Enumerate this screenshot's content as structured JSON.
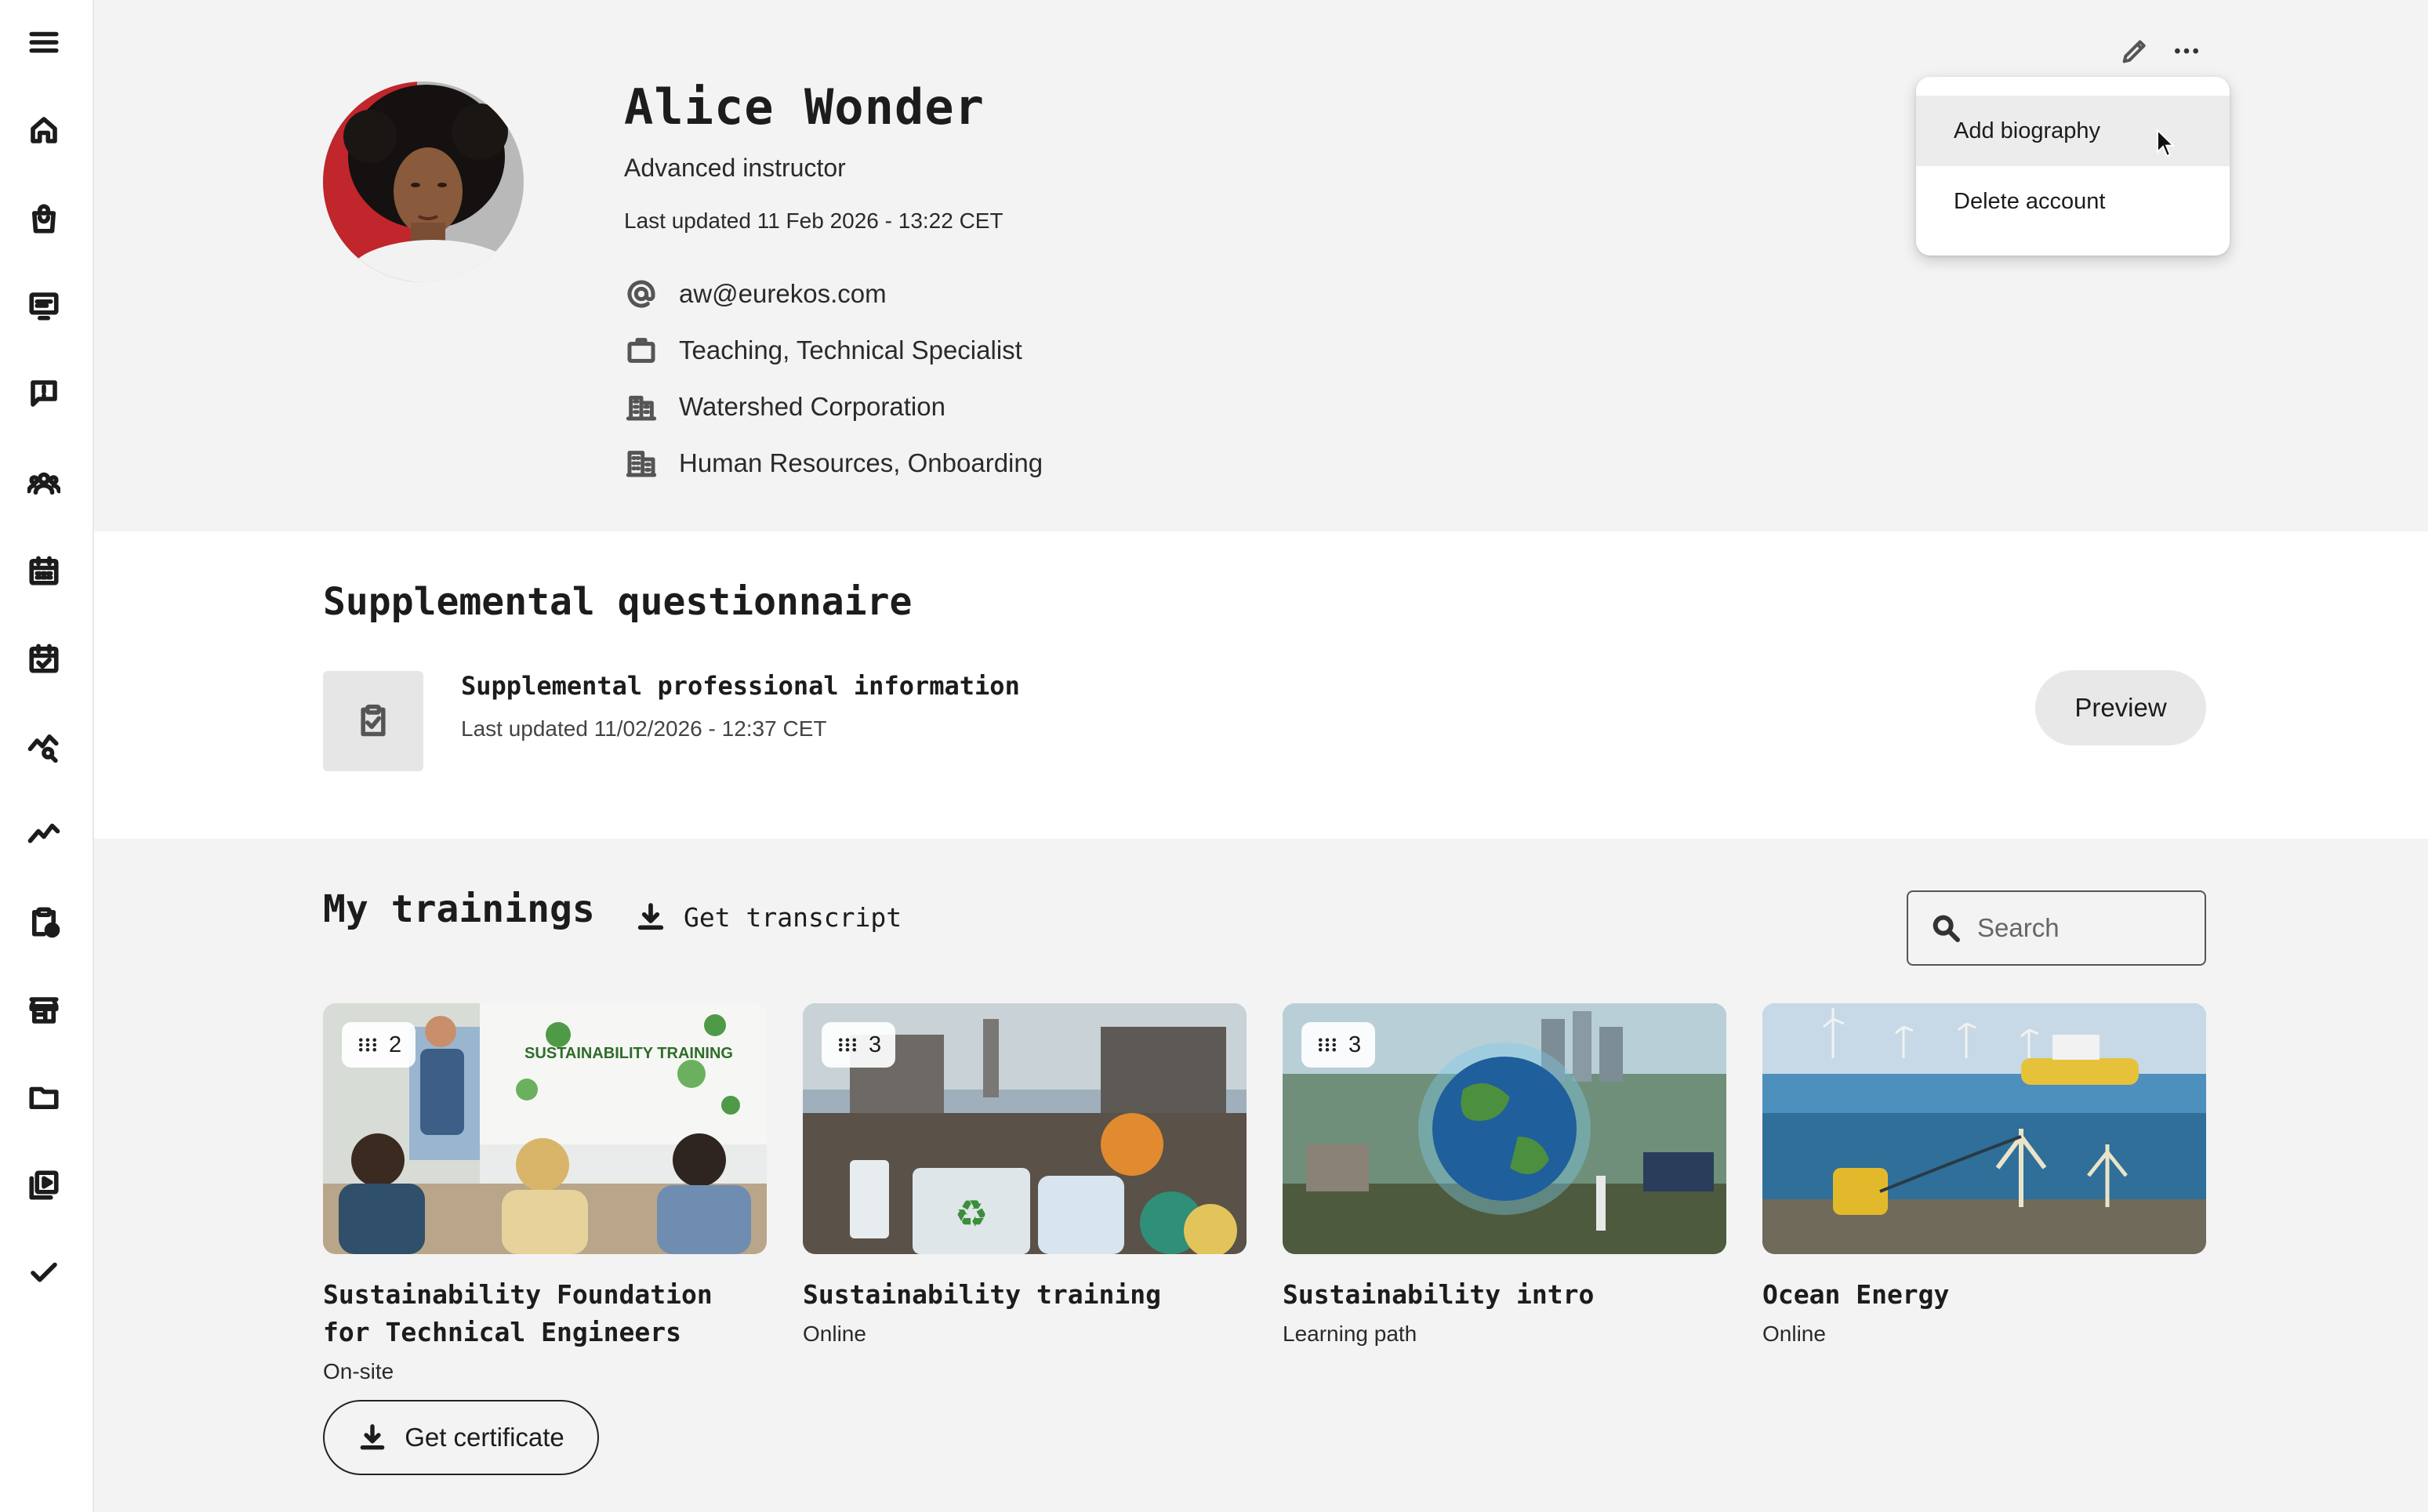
{
  "sidebar": {
    "items": [
      {
        "name": "menu-icon"
      },
      {
        "name": "home-icon"
      },
      {
        "name": "shopping-bag-icon"
      },
      {
        "name": "presentation-icon"
      },
      {
        "name": "feedback-icon"
      },
      {
        "name": "users-icon"
      },
      {
        "name": "calendar-icon"
      },
      {
        "name": "calendar-check-icon"
      },
      {
        "name": "analytics-search-icon"
      },
      {
        "name": "trending-icon"
      },
      {
        "name": "clipboard-clock-icon"
      },
      {
        "name": "store-icon"
      },
      {
        "name": "folder-icon"
      },
      {
        "name": "video-library-icon"
      },
      {
        "name": "check-icon"
      }
    ]
  },
  "profile": {
    "name": "Alice Wonder",
    "role": "Advanced instructor",
    "last_updated": "Last updated 11 Feb 2026 - 13:22 CET",
    "email": "aw@eurekos.com",
    "job": "Teaching, Technical Specialist",
    "organization": "Watershed Corporation",
    "department": "Human Resources, Onboarding"
  },
  "menu": {
    "items": [
      "Add biography",
      "Delete account"
    ],
    "hovered": "Add biography"
  },
  "questionnaire": {
    "section_title": "Supplemental questionnaire",
    "name": "Supplemental professional information",
    "last_updated": "Last updated 11/02/2026 - 12:37 CET",
    "preview_label": "Preview"
  },
  "trainings": {
    "section_title": "My trainings",
    "transcript_label": "Get transcript",
    "search_placeholder": "Search",
    "certificate_label": "Get certificate",
    "cards": [
      {
        "title": "Sustainability Foundation for Technical Engineers",
        "type": "On-site",
        "count": "2"
      },
      {
        "title": "Sustainability training",
        "type": "Online",
        "count": "3"
      },
      {
        "title": "Sustainability intro",
        "type": "Learning path",
        "count": "3"
      },
      {
        "title": "Ocean Energy",
        "type": "Online",
        "count": ""
      }
    ],
    "thumbnail_text": "SUSTAINABILITY TRAINING"
  },
  "colors": {
    "background": "#f3f3f3",
    "surface": "#ffffff",
    "text": "#1c1c1c",
    "button_bg": "#e8e8e8"
  }
}
